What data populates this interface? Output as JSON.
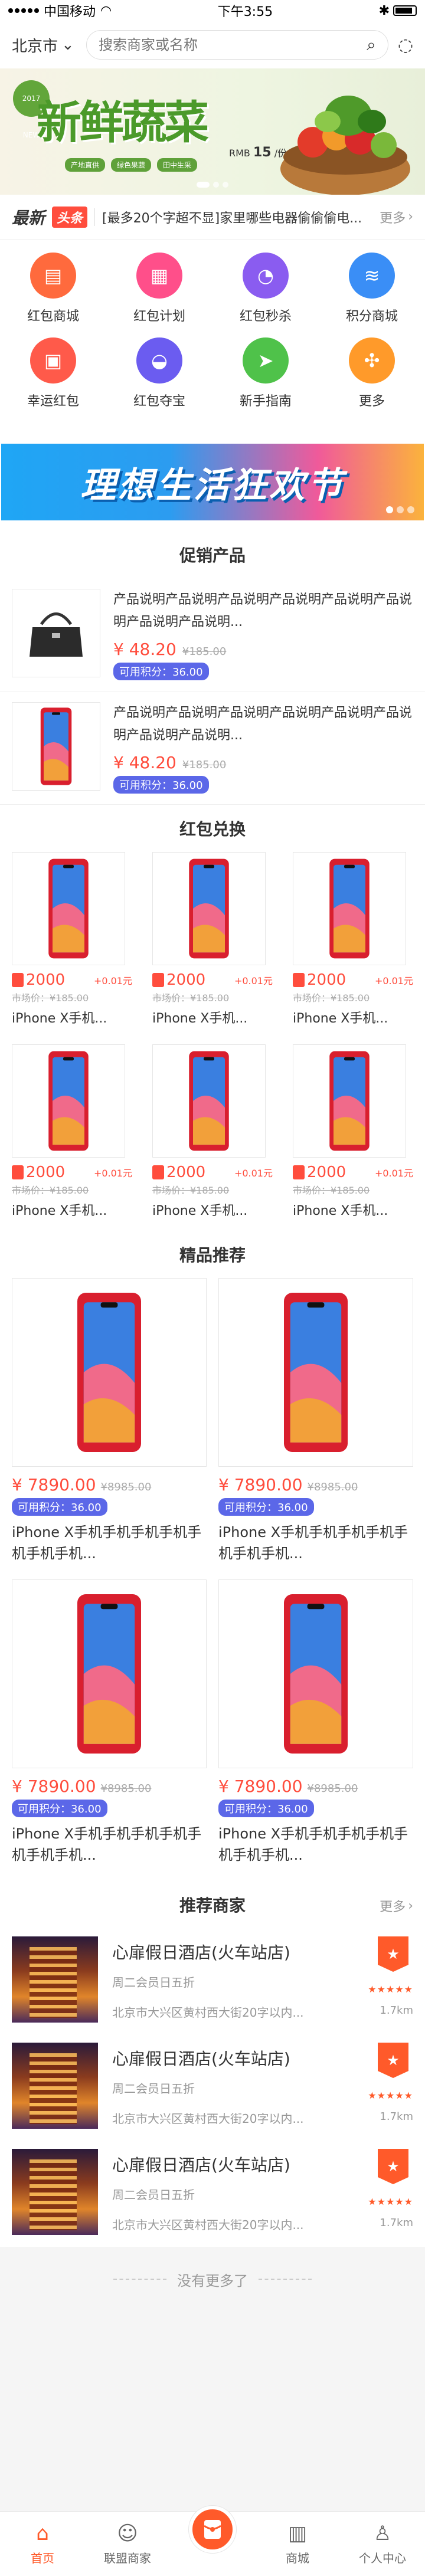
{
  "status_bar": {
    "carrier": "中国移动",
    "time": "下午3:55"
  },
  "search": {
    "city": "北京市",
    "placeholder": "搜索商家或名称"
  },
  "banner": {
    "badge": "2017 NEW",
    "title": "新鲜蔬菜",
    "tags": [
      "产地直供",
      "绿色果蔬",
      "田中生采"
    ],
    "price_label": "RMB",
    "price_value": "15",
    "price_unit": "/份"
  },
  "news": {
    "brand": "最新",
    "tag": "头条",
    "text": "[最多20个字超不显]家里哪些电器偷偷偷电...",
    "more": "更多"
  },
  "icons": [
    {
      "label": "红包商城",
      "color": "#ff6a3d",
      "glyph": "▤"
    },
    {
      "label": "红包计划",
      "color": "#ff4f8a",
      "glyph": "▦"
    },
    {
      "label": "红包秒杀",
      "color": "#8a5cf0",
      "glyph": "◔"
    },
    {
      "label": "积分商城",
      "color": "#3a8ef6",
      "glyph": "≋"
    },
    {
      "label": "幸运红包",
      "color": "#ff5a4a",
      "glyph": "▣"
    },
    {
      "label": "红包夺宝",
      "color": "#6b5cf0",
      "glyph": "◒"
    },
    {
      "label": "新手指南",
      "color": "#4fc24a",
      "glyph": "➤"
    },
    {
      "label": "更多",
      "color": "#ff9a2a",
      "glyph": "✣"
    }
  ],
  "promo_banner": {
    "text": "理想生活狂欢节"
  },
  "promotion": {
    "title": "促销产品",
    "items": [
      {
        "desc": "产品说明产品说明产品说明产品说明产品说明产品说明产品说明产品说明...",
        "price": "¥ 48.20",
        "old_price": "¥185.00",
        "points": "可用积分：36.00",
        "img": "bag"
      },
      {
        "desc": "产品说明产品说明产品说明产品说明产品说明产品说明产品说明产品说明...",
        "price": "¥ 48.20",
        "old_price": "¥185.00",
        "points": "可用积分：36.00",
        "img": "phone"
      }
    ]
  },
  "redpack": {
    "title": "红包兑换",
    "items": [
      {
        "price": "2000",
        "bonus": "+0.01元",
        "old": "市场价：¥185.00",
        "name": "iPhone X手机..."
      },
      {
        "price": "2000",
        "bonus": "+0.01元",
        "old": "市场价：¥185.00",
        "name": "iPhone X手机..."
      },
      {
        "price": "2000",
        "bonus": "+0.01元",
        "old": "市场价：¥185.00",
        "name": "iPhone X手机..."
      },
      {
        "price": "2000",
        "bonus": "+0.01元",
        "old": "市场价：¥185.00",
        "name": "iPhone X手机..."
      },
      {
        "price": "2000",
        "bonus": "+0.01元",
        "old": "市场价：¥185.00",
        "name": "iPhone X手机..."
      },
      {
        "price": "2000",
        "bonus": "+0.01元",
        "old": "市场价：¥185.00",
        "name": "iPhone X手机..."
      }
    ]
  },
  "featured": {
    "title": "精品推荐",
    "items": [
      {
        "price": "¥ 7890.00",
        "old": "¥8985.00",
        "points": "可用积分：36.00",
        "name": "iPhone X手机手机手机手机手机手机手机..."
      },
      {
        "price": "¥ 7890.00",
        "old": "¥8985.00",
        "points": "可用积分：36.00",
        "name": "iPhone X手机手机手机手机手机手机手机..."
      },
      {
        "price": "¥ 7890.00",
        "old": "¥8985.00",
        "points": "可用积分：36.00",
        "name": "iPhone X手机手机手机手机手机手机手机..."
      },
      {
        "price": "¥ 7890.00",
        "old": "¥8985.00",
        "points": "可用积分：36.00",
        "name": "iPhone X手机手机手机手机手机手机手机..."
      }
    ]
  },
  "merchants": {
    "title": "推荐商家",
    "more": "更多",
    "items": [
      {
        "name": "心扉假日酒店(火车站店)",
        "sub": "周二会员日五折",
        "addr": "北京市大兴区黄村西大街20字以内...",
        "dist": "1.7km",
        "stars": "★★★★★"
      },
      {
        "name": "心扉假日酒店(火车站店)",
        "sub": "周二会员日五折",
        "addr": "北京市大兴区黄村西大街20字以内...",
        "dist": "1.7km",
        "stars": "★★★★★"
      },
      {
        "name": "心扉假日酒店(火车站店)",
        "sub": "周二会员日五折",
        "addr": "北京市大兴区黄村西大街20字以内...",
        "dist": "1.7km",
        "stars": "★★★★★"
      }
    ]
  },
  "footer": {
    "no_more": "没有更多了"
  },
  "tabbar": {
    "items": [
      "首页",
      "联盟商家",
      "",
      "商城",
      "个人中心"
    ]
  },
  "colors": {
    "accent": "#ff5a2a",
    "price": "#ff4d3d",
    "points": "#5b67e8"
  }
}
